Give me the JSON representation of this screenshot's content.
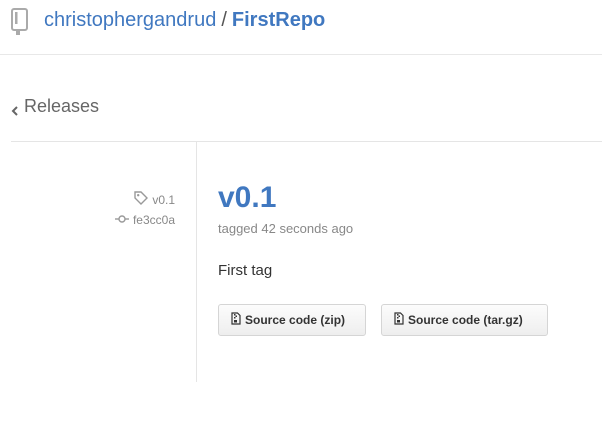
{
  "header": {
    "owner": "christophergandrud",
    "separator": "/",
    "repo": "FirstRepo",
    "repo_icon": "repo-book-icon"
  },
  "breadcrumb": {
    "label": "Releases",
    "icon": "chevron-left-icon"
  },
  "release": {
    "tag": "v0.1",
    "commit": "fe3cc0a",
    "title": "v0.1",
    "tagged_text": "tagged 42 seconds ago",
    "body": "First tag",
    "downloads": [
      {
        "label": "Source code (zip)",
        "icon": "file-zip-icon"
      },
      {
        "label": "Source code (tar.gz)",
        "icon": "file-zip-icon"
      }
    ]
  },
  "colors": {
    "link": "#4078c0",
    "muted": "#888888"
  }
}
